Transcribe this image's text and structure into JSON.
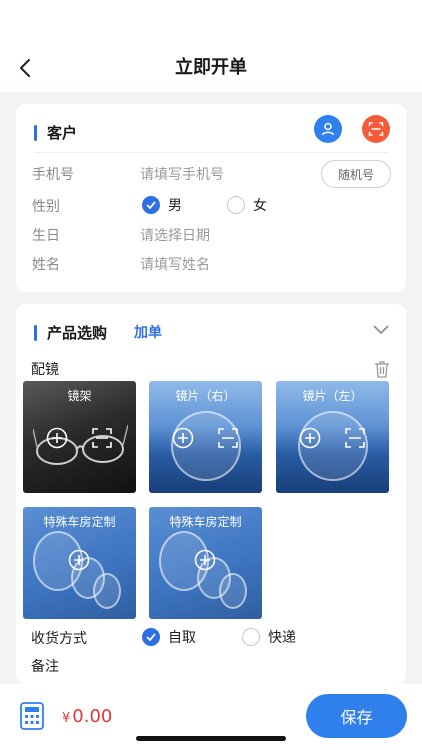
{
  "header": {
    "title": "立即开单"
  },
  "customer": {
    "section_title": "客户",
    "phone": {
      "label": "手机号",
      "placeholder": "请填写手机号",
      "random_button": "随机号"
    },
    "gender": {
      "label": "性别",
      "options": [
        "男",
        "女"
      ],
      "selected": "男"
    },
    "birthday": {
      "label": "生日",
      "placeholder": "请选择日期"
    },
    "name": {
      "label": "姓名",
      "placeholder": "请填写姓名"
    }
  },
  "product": {
    "section_title": "产品选购",
    "add_order": "加单",
    "group_title": "配镜",
    "tiles": [
      {
        "label": "镜架"
      },
      {
        "label": "镜片（右）"
      },
      {
        "label": "镜片（左）"
      },
      {
        "label": "特殊车房定制"
      },
      {
        "label": "特殊车房定制"
      }
    ],
    "delivery": {
      "label": "收货方式",
      "options": [
        "自取",
        "快递"
      ],
      "selected": "自取"
    },
    "remark": {
      "label": "备注"
    }
  },
  "footer": {
    "currency": "¥",
    "total": "0.00",
    "save_label": "保存"
  },
  "colors": {
    "accent": "#2f80ed",
    "price": "#e53935",
    "scan": "#f25c3b"
  }
}
